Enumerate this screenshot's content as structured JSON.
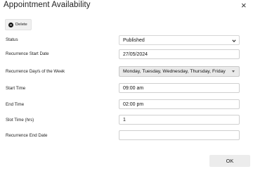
{
  "dialog": {
    "title": "Appointment Availability",
    "close_glyph": "×",
    "delete_label": "Delete",
    "ok_label": "OK"
  },
  "form": {
    "status": {
      "label": "Status",
      "value": "Published"
    },
    "recurrence_start_date": {
      "label": "Recurrence Start Date",
      "value": "27/05/2024"
    },
    "recurrence_days": {
      "label": "Recurrence Day/s of the Week",
      "value": "Monday, Tuesday, Wednesday, Thursday, Friday"
    },
    "start_time": {
      "label": "Start Time",
      "value": "09:00 am"
    },
    "end_time": {
      "label": "End Time",
      "value": "02:00 pm"
    },
    "slot_time": {
      "label": "Slot Time (hrs)",
      "value": "1"
    },
    "recurrence_end_date": {
      "label": "Recurrence End Date",
      "value": ""
    }
  },
  "icons": {
    "delete": "minus-circle-icon",
    "status_dropdown": "chevron-down-icon",
    "days_dropdown": "caret-down-icon",
    "close": "close-icon"
  }
}
